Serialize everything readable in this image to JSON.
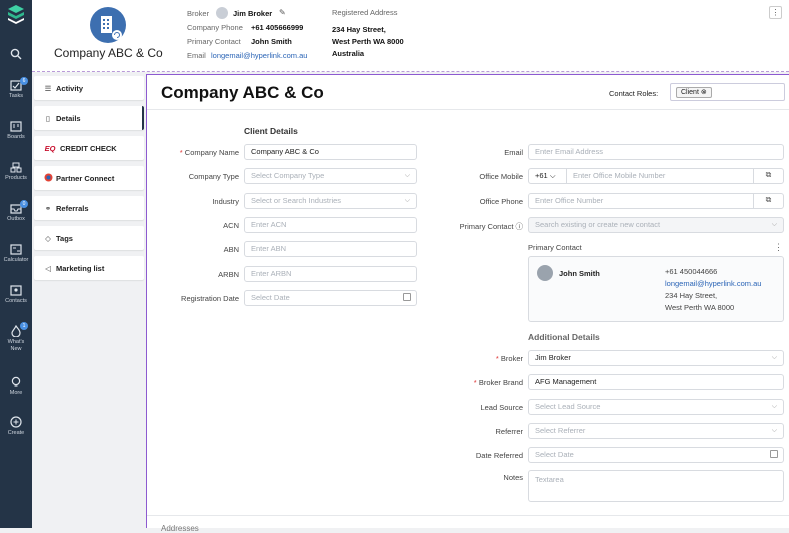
{
  "rail": {
    "items": [
      {
        "label": "Tasks",
        "badge": "6",
        "icon": "tasks-icon"
      },
      {
        "label": "Boards",
        "icon": "boards-icon"
      },
      {
        "label": "Products",
        "icon": "products-icon"
      },
      {
        "label": "Outbox",
        "badge": "0",
        "icon": "outbox-icon"
      },
      {
        "label": "Calculator",
        "icon": "calculator-icon"
      },
      {
        "label": "Contacts",
        "icon": "contacts-icon"
      },
      {
        "label": "What's New",
        "badge": "1",
        "icon": "whats-new-icon"
      },
      {
        "label": "More",
        "icon": "lightbulb-icon"
      },
      {
        "label": "Create",
        "icon": "plus-circle-icon"
      }
    ]
  },
  "header": {
    "company_name": "Company ABC & Co",
    "broker_label": "Broker",
    "broker_value": "Jim Broker",
    "phone_label": "Company Phone",
    "phone_value": "+61 405666999",
    "primary_label": "Primary Contact",
    "primary_value": "John Smith",
    "email_label": "Email",
    "email_value": "longemail@hyperlink.com.au",
    "address_label": "Registered Address",
    "address_line1": "234 Hay Street,",
    "address_line2": "West Perth WA 8000",
    "address_line3": "Australia"
  },
  "subnav": [
    {
      "label": "Activity",
      "icon": "list-icon"
    },
    {
      "label": "Details",
      "icon": "document-icon"
    },
    {
      "label": "CREDIT CHECK",
      "icon": "eq-logo-icon"
    },
    {
      "label": "Partner Connect",
      "icon": "partner-icon"
    },
    {
      "label": "Referrals",
      "icon": "referrals-icon"
    },
    {
      "label": "Tags",
      "icon": "tag-icon"
    },
    {
      "label": "Marketing list",
      "icon": "megaphone-icon"
    }
  ],
  "main": {
    "title": "Company ABC & Co",
    "contact_roles_label": "Contact Roles:",
    "role_chip": "Client",
    "client_details_title": "Client Details",
    "left_fields": [
      {
        "label": "Company Name",
        "required": true,
        "value": "Company ABC & Co",
        "placeholder": ""
      },
      {
        "label": "Company Type",
        "required": false,
        "value": "",
        "placeholder": "Select Company Type"
      },
      {
        "label": "Industry",
        "required": false,
        "value": "",
        "placeholder": "Select or Search Industries"
      },
      {
        "label": "ACN",
        "required": false,
        "value": "",
        "placeholder": "Enter ACN"
      },
      {
        "label": "ABN",
        "required": false,
        "value": "",
        "placeholder": "Enter ABN"
      },
      {
        "label": "ARBN",
        "required": false,
        "value": "",
        "placeholder": "Enter ARBN"
      },
      {
        "label": "Registration Date",
        "required": false,
        "value": "",
        "placeholder": "Select Date"
      }
    ],
    "email_label": "Email",
    "email_placeholder": "Enter Email Address",
    "office_mobile_label": "Office Mobile",
    "country_code": "+61",
    "office_mobile_placeholder": "Enter Office Mobile Number",
    "office_phone_label": "Office Phone",
    "office_phone_placeholder": "Enter Office Number",
    "primary_contact_label": "Primary Contact",
    "primary_contact_placeholder": "Search existing or create new contact",
    "primary_contact_card_title": "Primary Contact",
    "pc_name": "John Smith",
    "pc_phone": "+61 450044666",
    "pc_email": "longemail@hyperlink.com.au",
    "pc_addr1": "234 Hay Street,",
    "pc_addr2": "West Perth WA 8000",
    "additional_title": "Additional Details",
    "additional_fields": [
      {
        "label": "Broker",
        "required": true,
        "value": "Jim Broker",
        "placeholder": ""
      },
      {
        "label": "Broker Brand",
        "required": true,
        "value": "AFG Management",
        "placeholder": ""
      },
      {
        "label": "Lead Source",
        "required": false,
        "value": "",
        "placeholder": "Select Lead Source"
      },
      {
        "label": "Referrer",
        "required": false,
        "value": "",
        "placeholder": "Select Referrer"
      },
      {
        "label": "Date Referred",
        "required": false,
        "value": "",
        "placeholder": "Select Date"
      }
    ],
    "notes_label": "Notes",
    "notes_placeholder": "Textarea",
    "bottom_section": "Addresses"
  }
}
